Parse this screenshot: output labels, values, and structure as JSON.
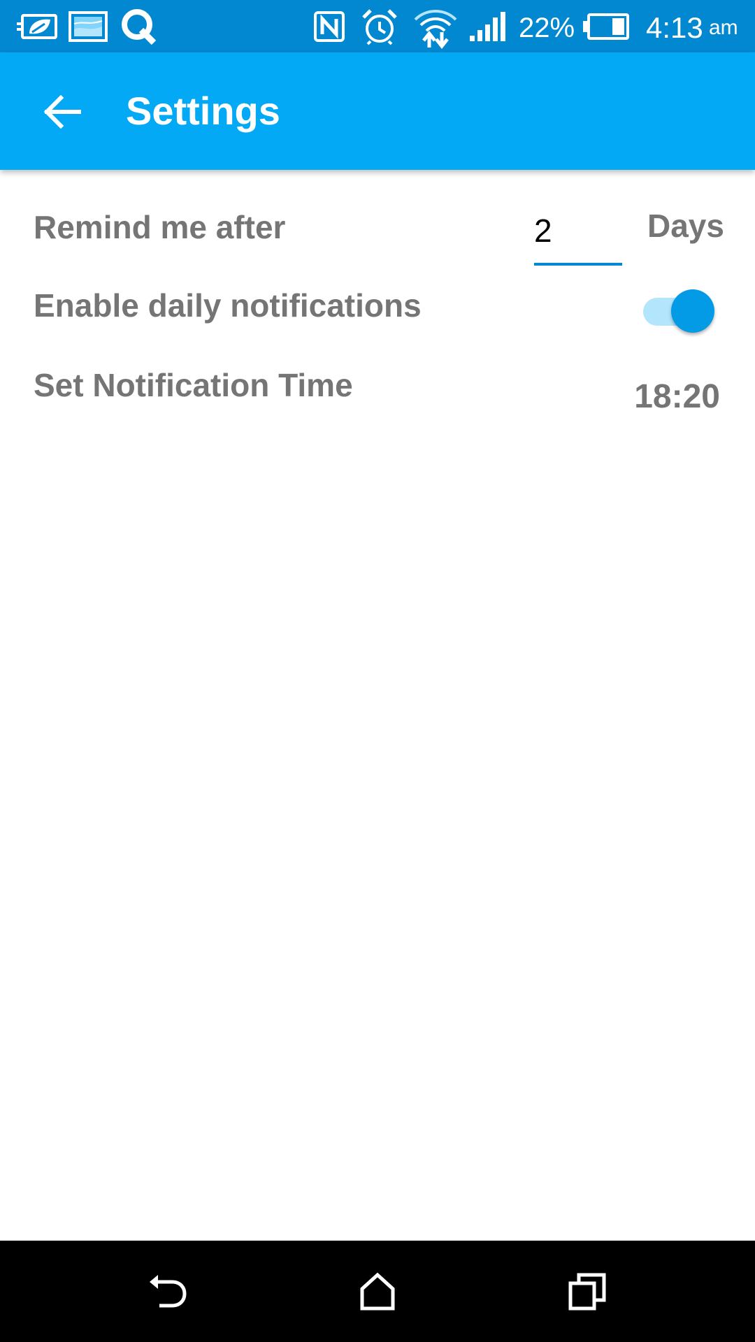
{
  "status_bar": {
    "battery_percent": "22%",
    "time": "4:13",
    "am_pm": "am",
    "icons": [
      "leaf-battery-saver-icon",
      "image-icon",
      "q-app-icon",
      "nfc-icon",
      "alarm-icon",
      "wifi-icon",
      "signal-icon",
      "battery-icon"
    ]
  },
  "app_bar": {
    "title": "Settings",
    "back_icon": "arrow-left-icon",
    "color": "#03a9f4"
  },
  "settings": {
    "remind": {
      "label": "Remind me after",
      "value": "2",
      "unit": "Days"
    },
    "daily_notifications": {
      "label": "Enable daily notifications",
      "enabled": true
    },
    "notification_time": {
      "label": "Set Notification Time",
      "value": "18:20"
    }
  },
  "nav_bar": {
    "buttons": [
      "back-icon",
      "home-icon",
      "recents-icon"
    ]
  },
  "colors": {
    "status_bar": "#0288d1",
    "accent": "#039be5",
    "text_secondary": "#757575"
  }
}
